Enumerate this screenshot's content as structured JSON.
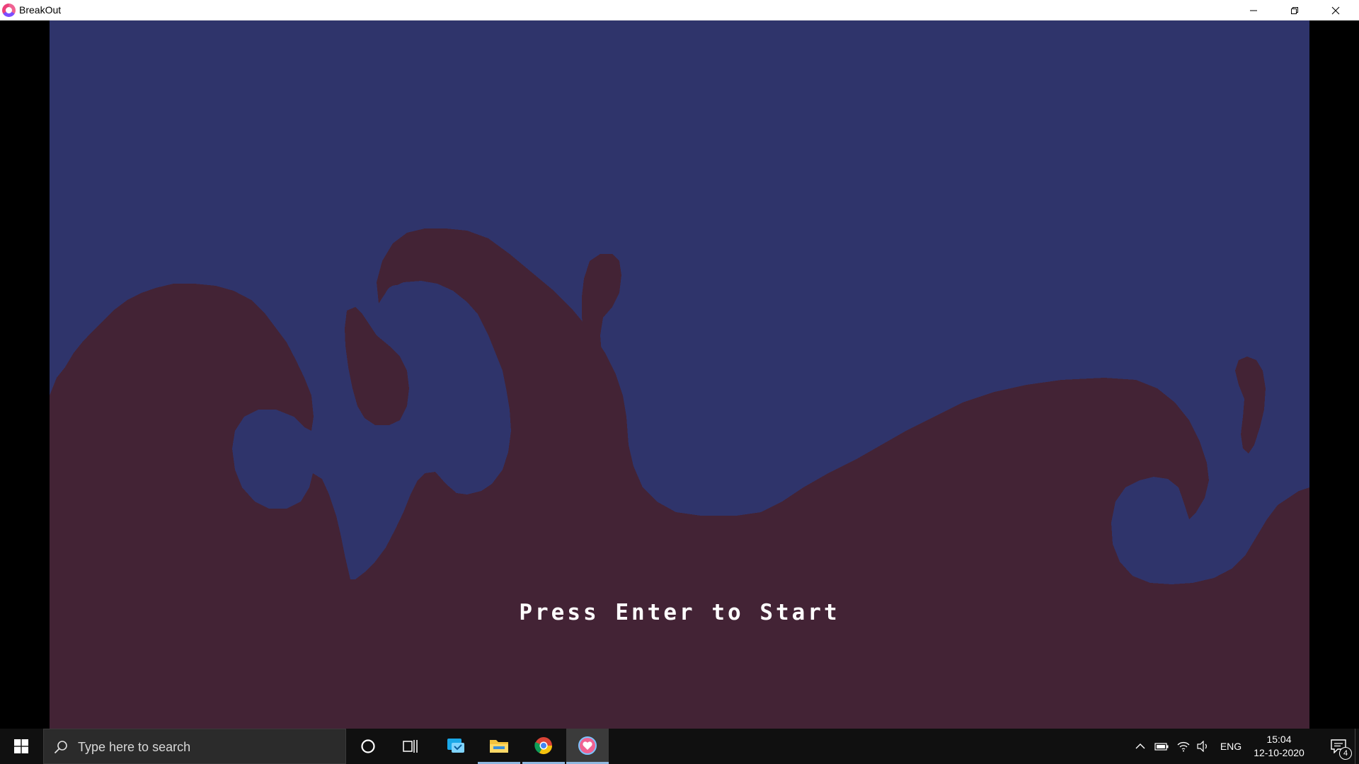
{
  "window": {
    "title": "BreakOut",
    "app_icon": "breakout-heart-icon",
    "controls": [
      "minimize-icon",
      "restore-icon",
      "close-icon"
    ]
  },
  "game": {
    "prompt": "Press Enter to Start",
    "colors": {
      "sky": "#2f346b",
      "waves": "#432335",
      "prompt_text": "#ffffff",
      "letterbox": "#000000"
    }
  },
  "taskbar": {
    "start_icon": "windows-logo-icon",
    "search": {
      "placeholder": "Type here to search",
      "icon": "search-icon"
    },
    "cortana_icon": "cortana-circle-icon",
    "task_view_icon": "task-view-icon",
    "pinned_apps": [
      {
        "name": "feedback-hub",
        "icon": "feedback-icon",
        "running": false
      },
      {
        "name": "file-explorer",
        "icon": "folder-icon",
        "running": true
      },
      {
        "name": "chrome",
        "icon": "chrome-icon",
        "running": true
      },
      {
        "name": "breakout",
        "icon": "breakout-heart-icon",
        "running": true,
        "active": true
      }
    ],
    "tray": {
      "icons": [
        "chevron-up-icon",
        "battery-icon",
        "wifi-icon",
        "volume-icon"
      ],
      "language": "ENG",
      "time": "15:04",
      "date": "12-10-2020",
      "notifications": "4"
    }
  }
}
